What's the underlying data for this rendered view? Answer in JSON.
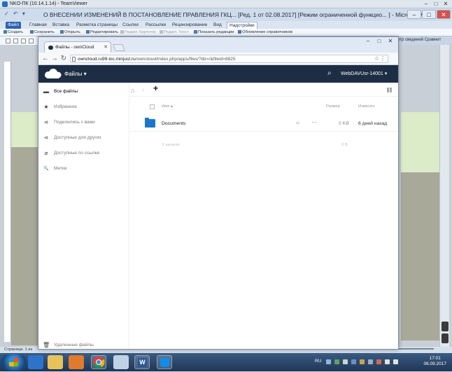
{
  "teamviewer": {
    "title": "NKO-ПК (10.14.1.14) - TeamViewer",
    "min": "–",
    "max": "□",
    "close": "✕"
  },
  "word": {
    "quick_access": "✓ ↶ ▾",
    "title": "О ВНЕСЕНИИ ИЗМЕНЕНИЙ В ПОСТАНОВЛЕНИЕ ПРАВЛЕНИЯ ГКЦ... [Ред. 1 от 02.08.2017] [Режим ограниченной функцио... ] - Microsoft Word",
    "tabs": [
      "Файл",
      "Главная",
      "Вставка",
      "Разметка страницы",
      "Ссылки",
      "Рассылки",
      "Рецензирование",
      "Вид",
      "Надстройки"
    ],
    "toolbar": [
      {
        "label": "Создать",
        "enabled": true
      },
      {
        "label": "Сохранить",
        "enabled": true
      },
      {
        "label": "Открыть",
        "enabled": true
      },
      {
        "label": "Редактировать",
        "enabled": true
      },
      {
        "label": "Редакт. Карточку",
        "enabled": false
      },
      {
        "label": "Редакт. Текст",
        "enabled": false
      },
      {
        "label": "Показать редакции",
        "enabled": true
      },
      {
        "label": "Обновление справочников",
        "enabled": true
      }
    ],
    "right_label": "отр сведений   Сравнит",
    "status": "Страница: 1 из"
  },
  "chrome": {
    "tab_title": "Файлы - ownCloud",
    "url_host": "owncloud.ru99-loc.minjust.ru",
    "url_path": "/owncloud/index.php/apps/files/?dir=/&fileid=8825"
  },
  "owncloud": {
    "apps_menu": "Файлы ▾",
    "user": "WebDAVUsr-14001 ▾",
    "sidebar": [
      {
        "label": "Все файлы",
        "icon": "folder-icon",
        "glyph": "▬",
        "active": true
      },
      {
        "label": "Избранное",
        "icon": "star-icon",
        "glyph": "★",
        "active": false
      },
      {
        "label": "Поделились с вами",
        "icon": "share-icon",
        "glyph": "⋖",
        "active": false
      },
      {
        "label": "Доступные для других",
        "icon": "share-icon",
        "glyph": "⋖",
        "active": false
      },
      {
        "label": "Доступные по ссылке",
        "icon": "link-icon",
        "glyph": "⌀",
        "active": false
      },
      {
        "label": "Метки",
        "icon": "tag-icon",
        "glyph": "🔍",
        "active": false
      }
    ],
    "trash": "Удаленные файлы",
    "table_headers": {
      "name": "Имя ▴",
      "size": "Размер",
      "modified": "Изменён"
    },
    "files": [
      {
        "name": "Documents",
        "size": "0 KB",
        "modified": "6 дней назад"
      }
    ],
    "summary": {
      "count": "1 каталог",
      "size": "0 B"
    }
  },
  "taskbar": {
    "lang": "RU",
    "time": "17:01",
    "date": "06.09.2017"
  }
}
